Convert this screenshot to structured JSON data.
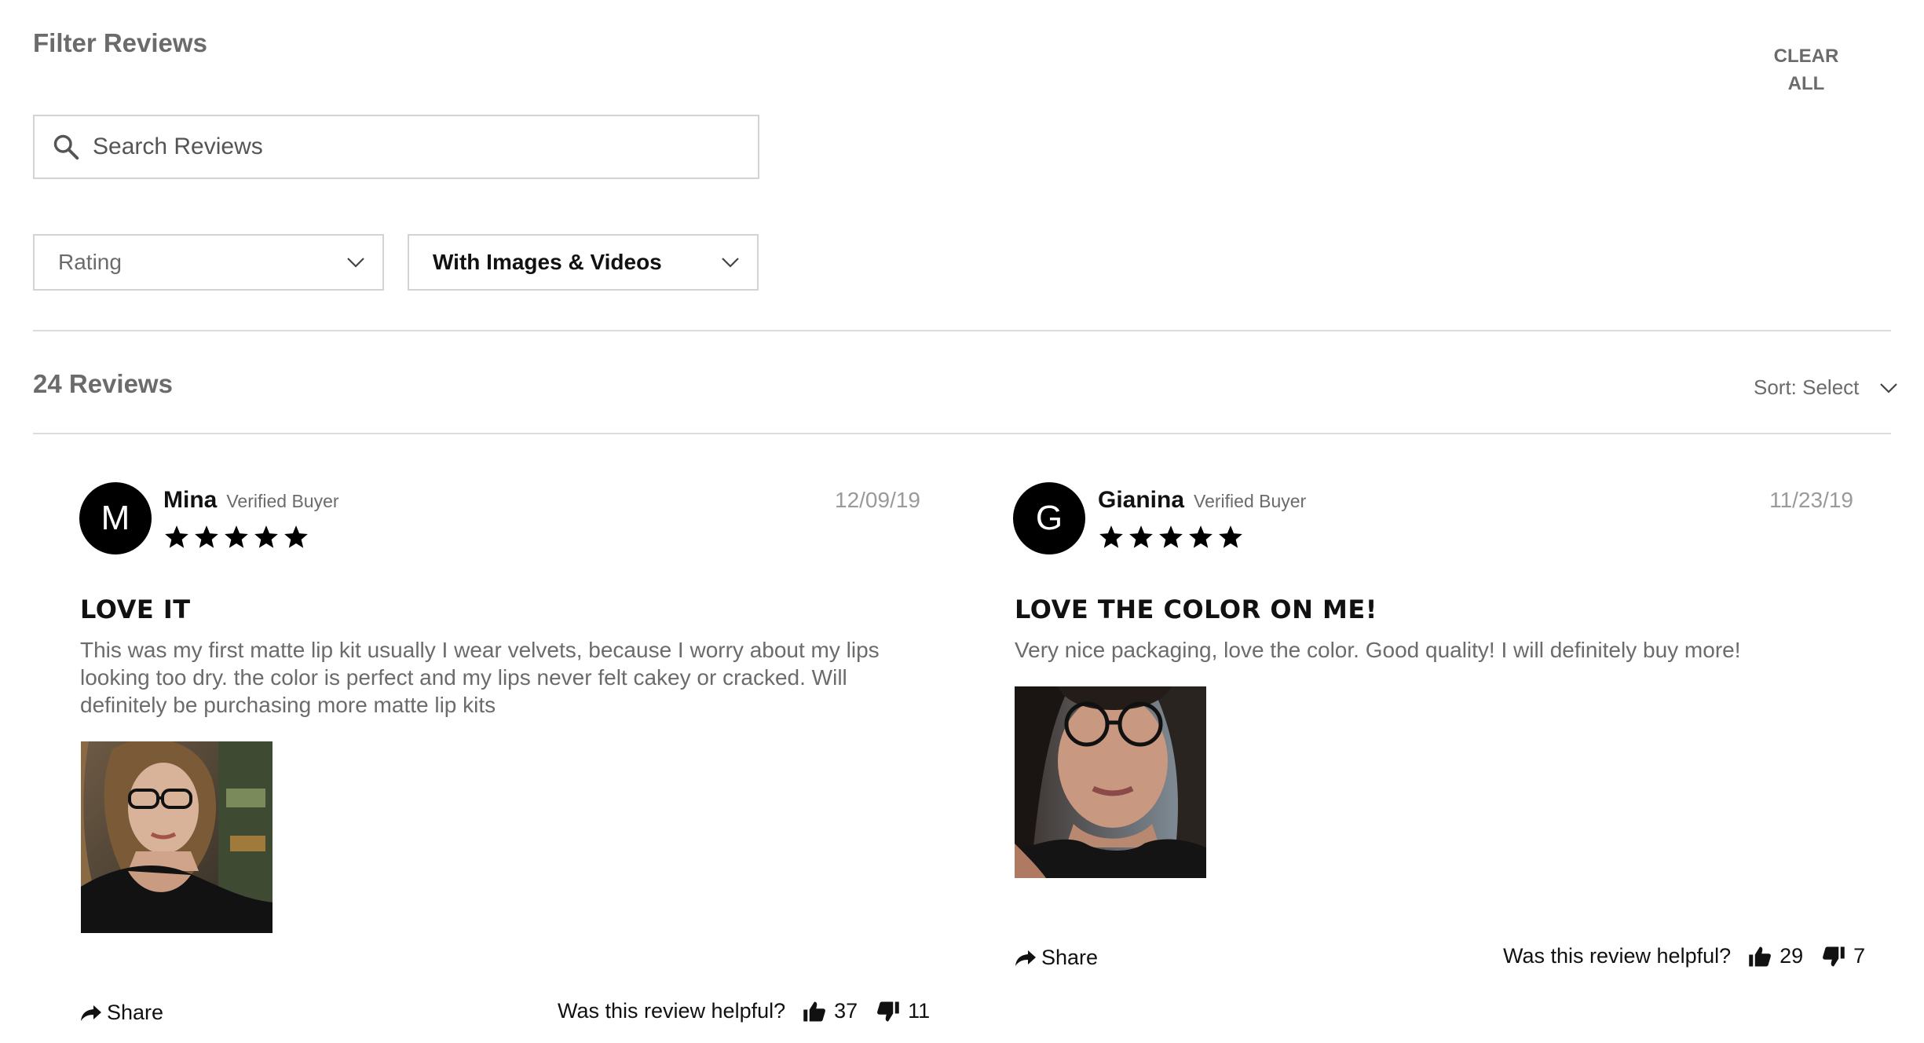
{
  "filters": {
    "title": "Filter Reviews",
    "clear_all_line1": "CLEAR",
    "clear_all_line2": "ALL",
    "search_placeholder": "Search Reviews",
    "rating_label": "Rating",
    "media_label": "With Images & Videos"
  },
  "summary": {
    "count_label": "24 Reviews",
    "sort_label": "Sort: Select"
  },
  "colors": {
    "star": "#000000",
    "muted_text": "#6b6b6b",
    "border": "#d3d3d3"
  },
  "reviews": [
    {
      "initial": "M",
      "name": "Mina",
      "badge": "Verified Buyer",
      "date": "12/09/19",
      "rating": 5,
      "title": "LOVE IT",
      "body_line1": "This was my first matte lip kit usually I wear velvets, because I worry about my lips",
      "body_line2": "looking too dry. the color is perfect and my lips never felt cakey or cracked. Will",
      "body_line3": "definitely be purchasing more matte lip kits",
      "share_label": "Share",
      "helpful_label": "Was this review helpful?",
      "helpful_yes": "37",
      "helpful_no": "11"
    },
    {
      "initial": "G",
      "name": "Gianina",
      "badge": "Verified Buyer",
      "date": "11/23/19",
      "rating": 5,
      "title": "LOVE THE COLOR ON ME!",
      "body_line1": "Very nice packaging, love the color. Good quality! I will definitely buy more!",
      "share_label": "Share",
      "helpful_label": "Was this review helpful?",
      "helpful_yes": "29",
      "helpful_no": "7"
    }
  ]
}
